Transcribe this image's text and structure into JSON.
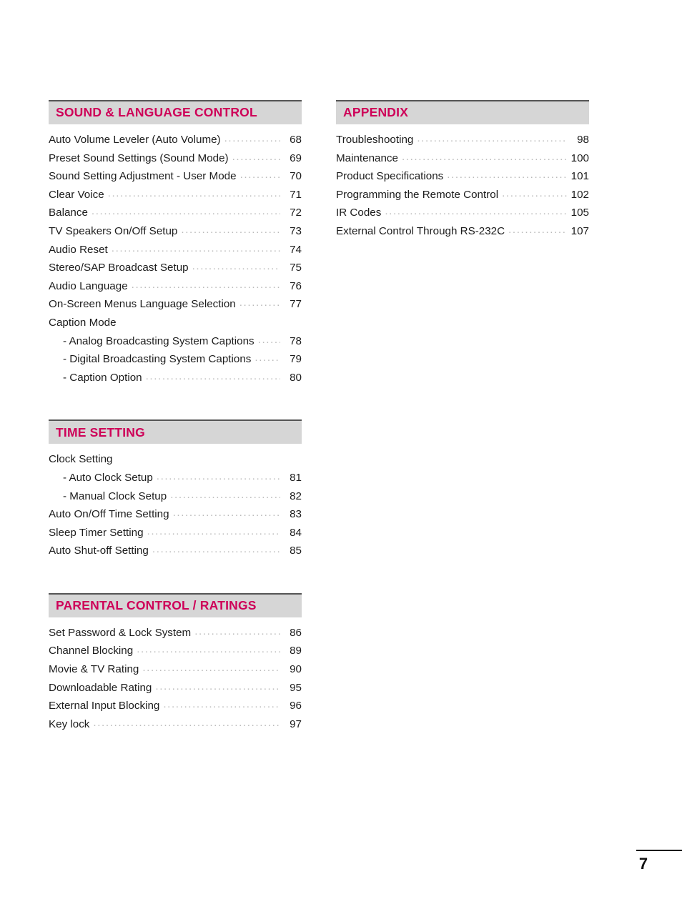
{
  "document": {
    "type": "table-of-contents",
    "page_number": "7",
    "accent_color": "#ce0058",
    "header_band_color": "#d6d6d6",
    "leader_color": "#b9b9b9"
  },
  "columns": [
    {
      "name": "left-column",
      "sections": [
        {
          "title": "SOUND & LANGUAGE CONTROL",
          "entries": [
            {
              "label": "Auto Volume Leveler (Auto Volume)",
              "page": "68",
              "indent": false
            },
            {
              "label": "Preset Sound Settings (Sound Mode)",
              "page": "69",
              "indent": false
            },
            {
              "label": "Sound Setting Adjustment - User Mode",
              "page": "70",
              "indent": false
            },
            {
              "label": "Clear Voice",
              "page": "71",
              "indent": false
            },
            {
              "label": "Balance",
              "page": "72",
              "indent": false
            },
            {
              "label": "TV Speakers On/Off Setup",
              "page": "73",
              "indent": false
            },
            {
              "label": "Audio Reset",
              "page": "74",
              "indent": false
            },
            {
              "label": "Stereo/SAP Broadcast Setup",
              "page": "75",
              "indent": false
            },
            {
              "label": "Audio Language",
              "page": "76",
              "indent": false
            },
            {
              "label": "On-Screen Menus Language Selection",
              "page": "77",
              "indent": false
            },
            {
              "label": "Caption Mode",
              "page": "",
              "indent": false,
              "no_leader": true
            },
            {
              "label": "- Analog Broadcasting System Captions",
              "page": "78",
              "indent": true
            },
            {
              "label": "- Digital Broadcasting System Captions",
              "page": "79",
              "indent": true
            },
            {
              "label": "- Caption Option",
              "page": "80",
              "indent": true
            }
          ]
        },
        {
          "title": "TIME SETTING",
          "entries": [
            {
              "label": "Clock Setting",
              "page": "",
              "indent": false,
              "no_leader": true
            },
            {
              "label": "- Auto Clock Setup",
              "page": "81",
              "indent": true
            },
            {
              "label": "- Manual Clock Setup",
              "page": "82",
              "indent": true
            },
            {
              "label": "Auto On/Off Time Setting",
              "page": "83",
              "indent": false
            },
            {
              "label": "Sleep Timer Setting",
              "page": "84",
              "indent": false
            },
            {
              "label": "Auto Shut-off Setting",
              "page": "85",
              "indent": false
            }
          ]
        },
        {
          "title": "PARENTAL CONTROL / RATINGS",
          "entries": [
            {
              "label": "Set Password & Lock System",
              "page": "86",
              "indent": false
            },
            {
              "label": "Channel Blocking",
              "page": "89",
              "indent": false
            },
            {
              "label": "Movie & TV Rating",
              "page": "90",
              "indent": false
            },
            {
              "label": "Downloadable Rating",
              "page": "95",
              "indent": false
            },
            {
              "label": "External Input Blocking",
              "page": "96",
              "indent": false
            },
            {
              "label": "Key lock",
              "page": "97",
              "indent": false
            }
          ]
        }
      ]
    },
    {
      "name": "right-column",
      "sections": [
        {
          "title": "APPENDIX",
          "entries": [
            {
              "label": "Troubleshooting",
              "page": "98",
              "indent": false
            },
            {
              "label": "Maintenance",
              "page": "100",
              "indent": false
            },
            {
              "label": "Product Specifications",
              "page": "101",
              "indent": false
            },
            {
              "label": "Programming the Remote Control",
              "page": "102",
              "indent": false
            },
            {
              "label": "IR Codes",
              "page": "105",
              "indent": false
            },
            {
              "label": "External Control Through RS-232C",
              "page": "107",
              "indent": false
            }
          ]
        }
      ]
    }
  ]
}
